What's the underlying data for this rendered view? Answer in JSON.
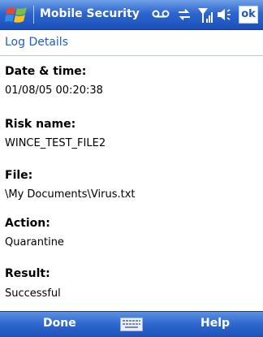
{
  "titlebar": {
    "app_title": "Mobile Security",
    "ok_label": "ok",
    "icons": [
      "windows-logo",
      "voicemail-icon",
      "sync-icon",
      "signal-icon",
      "volume-icon"
    ]
  },
  "header": {
    "title": "Log Details"
  },
  "details": [
    {
      "label": "Date & time:",
      "value": "01/08/05 00:20:38"
    },
    {
      "label": "Risk name:",
      "value": "WINCE_TEST_FILE2"
    },
    {
      "label": "File:",
      "value": "\\My Documents\\Virus.txt"
    },
    {
      "label": "Action:",
      "value": "Quarantine"
    },
    {
      "label": "Result:",
      "value": "Successful"
    }
  ],
  "menubar": {
    "left_label": "Done",
    "right_label": "Help",
    "center_icon": "keyboard-icon"
  },
  "colors": {
    "title_bar": "#2d66cf",
    "header_text": "#1f5fc7",
    "menu_bar": "#2d67cf"
  }
}
